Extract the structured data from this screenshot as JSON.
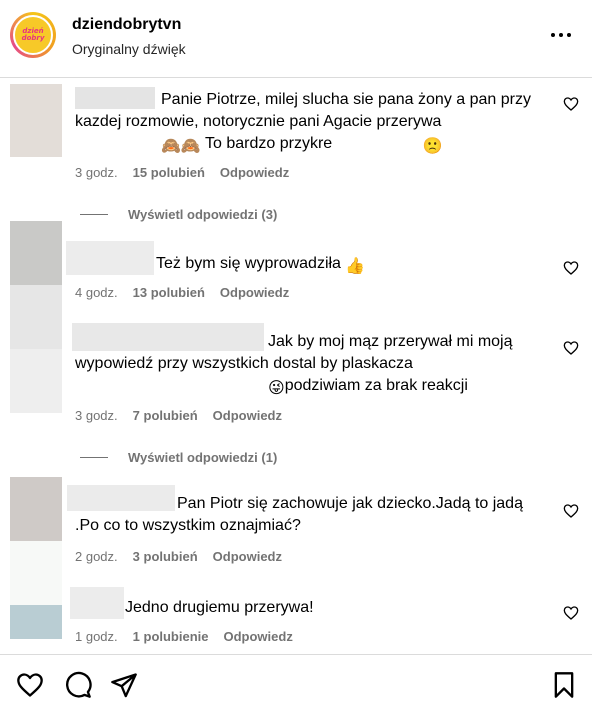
{
  "header": {
    "account_name": "dziendobrytvn",
    "audio_label": "Oryginalny dźwięk",
    "avatar_text_1": "dzień",
    "avatar_text_2": "dobry"
  },
  "comments": [
    {
      "text_before": "Panie Piotrze, milej slucha sie pana żony a pan przy kazdej rozmowie, notorycznie pani Agacie przerywa",
      "emoji_1": "🙈🙈",
      "text_after": " To bardzo przykre ",
      "emoji_2": "🙁",
      "time": "3 godz.",
      "likes": "15 polubień",
      "reply": "Odpowiedz"
    },
    {
      "text": "Też bym się wyprowadziła ",
      "emoji": "👍",
      "time": "4 godz.",
      "likes": "13 polubień",
      "reply": "Odpowiedz"
    },
    {
      "text_before": "Jak by moj mąz przerywał mi moją wypowiedź przy wszystkich dostal by plaskacza",
      "emoji": "😜",
      "text_after": "podziwiam za brak reakcji",
      "time": "3 godz.",
      "likes": "7 polubień",
      "reply": "Odpowiedz"
    },
    {
      "text": "Pan Piotr się zachowuje jak dziecko.Jadą to jadą .Po co to wszystkim oznajmiać?",
      "time": "2 godz.",
      "likes": "3 polubień",
      "reply": "Odpowiedz"
    },
    {
      "text": "Jedno drugiemu przerywa!",
      "time": "1 godz.",
      "likes": "1 polubienie",
      "reply": "Odpowiedz"
    }
  ],
  "view_replies": [
    {
      "label": "Wyświetl odpowiedzi (3)"
    },
    {
      "label": "Wyświetl odpowiedzi (1)"
    }
  ],
  "icons": {
    "more": "more-horizontal-icon",
    "like": "heart-icon",
    "comment": "comment-icon",
    "share": "send-icon",
    "save": "bookmark-icon"
  },
  "colors": {
    "secondary_text": "#737373",
    "divider": "#dbdbdb",
    "avatar_ring": "#f0a020"
  }
}
